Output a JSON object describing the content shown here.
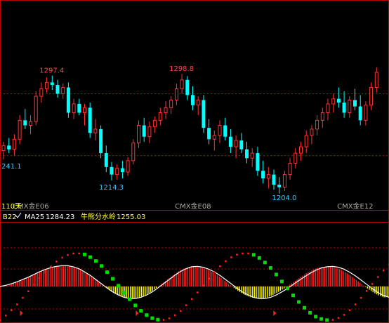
{
  "chart_data": [
    {
      "type": "candlestick",
      "title": "",
      "price_labels": [
        {
          "text": "1297.4",
          "kind": "high",
          "bar": 9
        },
        {
          "text": "1298.8",
          "kind": "high",
          "bar": 33
        },
        {
          "text": "241.1",
          "kind": "low",
          "bar": 0
        },
        {
          "text": "1214.3",
          "kind": "low",
          "bar": 20
        },
        {
          "text": "1204.0",
          "kind": "low",
          "bar": 52
        }
      ],
      "contract_labels": [
        {
          "text": "CMX金E06",
          "bar": 3
        },
        {
          "text": "CMX金E08",
          "bar": 33
        },
        {
          "text": "CMX金E12",
          "bar": 63
        }
      ],
      "period_label": "110天",
      "ylim": [
        1196,
        1310
      ],
      "reference_lines": [
        1283,
        1234
      ],
      "colors": {
        "up": "#ff3333",
        "down": "#00ffff",
        "ref": "#c00000",
        "high_label": "#ff4444",
        "low_label": "#33ccff"
      },
      "ohlc": [
        [
          1238,
          1245,
          1231,
          1242
        ],
        [
          1242,
          1248,
          1236,
          1239
        ],
        [
          1239,
          1251,
          1234,
          1247
        ],
        [
          1247,
          1266,
          1243,
          1262
        ],
        [
          1262,
          1271,
          1255,
          1258
        ],
        [
          1258,
          1266,
          1251,
          1261
        ],
        [
          1261,
          1285,
          1258,
          1281
        ],
        [
          1281,
          1292,
          1276,
          1287
        ],
        [
          1287,
          1296,
          1284,
          1292
        ],
        [
          1292,
          1297.4,
          1286,
          1290
        ],
        [
          1290,
          1294,
          1280,
          1283
        ],
        [
          1283,
          1291,
          1279,
          1288
        ],
        [
          1288,
          1292,
          1264,
          1268
        ],
        [
          1268,
          1279,
          1263,
          1275
        ],
        [
          1275,
          1279,
          1266,
          1268
        ],
        [
          1268,
          1275,
          1258,
          1272
        ],
        [
          1272,
          1276,
          1248,
          1252
        ],
        [
          1252,
          1263,
          1246,
          1255
        ],
        [
          1255,
          1258,
          1232,
          1236
        ],
        [
          1236,
          1242,
          1221,
          1225
        ],
        [
          1225,
          1229,
          1214.3,
          1219
        ],
        [
          1219,
          1227,
          1215,
          1224
        ],
        [
          1224,
          1230,
          1216,
          1221
        ],
        [
          1221,
          1233,
          1218,
          1230
        ],
        [
          1230,
          1247,
          1227,
          1244
        ],
        [
          1244,
          1262,
          1240,
          1258
        ],
        [
          1258,
          1264,
          1245,
          1249
        ],
        [
          1249,
          1261,
          1244,
          1257
        ],
        [
          1257,
          1265,
          1252,
          1262
        ],
        [
          1262,
          1272,
          1258,
          1268
        ],
        [
          1268,
          1277,
          1263,
          1272
        ],
        [
          1272,
          1281,
          1267,
          1278
        ],
        [
          1278,
          1291,
          1274,
          1287
        ],
        [
          1287,
          1298.8,
          1283,
          1294
        ],
        [
          1294,
          1297,
          1278,
          1282
        ],
        [
          1282,
          1289,
          1270,
          1274
        ],
        [
          1274,
          1281,
          1266,
          1278
        ],
        [
          1278,
          1282,
          1252,
          1256
        ],
        [
          1256,
          1263,
          1243,
          1247
        ],
        [
          1247,
          1254,
          1238,
          1250
        ],
        [
          1250,
          1262,
          1244,
          1258
        ],
        [
          1258,
          1264,
          1246,
          1249
        ],
        [
          1249,
          1255,
          1236,
          1241
        ],
        [
          1241,
          1250,
          1232,
          1246
        ],
        [
          1246,
          1252,
          1236,
          1239
        ],
        [
          1239,
          1245,
          1228,
          1232
        ],
        [
          1232,
          1240,
          1225,
          1236
        ],
        [
          1236,
          1241,
          1218,
          1222
        ],
        [
          1222,
          1230,
          1212,
          1216
        ],
        [
          1216,
          1225,
          1208,
          1219
        ],
        [
          1219,
          1223,
          1207,
          1211
        ],
        [
          1211,
          1217,
          1204.0,
          1209
        ],
        [
          1209,
          1222,
          1206,
          1219
        ],
        [
          1219,
          1232,
          1215,
          1228
        ],
        [
          1228,
          1240,
          1224,
          1236
        ],
        [
          1236,
          1245,
          1230,
          1241
        ],
        [
          1241,
          1254,
          1236,
          1250
        ],
        [
          1250,
          1258,
          1243,
          1255
        ],
        [
          1255,
          1266,
          1250,
          1262
        ],
        [
          1262,
          1272,
          1256,
          1268
        ],
        [
          1268,
          1279,
          1262,
          1275
        ],
        [
          1275,
          1283,
          1268,
          1279
        ],
        [
          1279,
          1288,
          1272,
          1276
        ],
        [
          1276,
          1285,
          1264,
          1268
        ],
        [
          1268,
          1281,
          1264,
          1278
        ],
        [
          1278,
          1287,
          1270,
          1273
        ],
        [
          1273,
          1282,
          1258,
          1262
        ],
        [
          1262,
          1277,
          1258,
          1274
        ],
        [
          1274,
          1292,
          1270,
          1288
        ],
        [
          1288,
          1304,
          1284,
          1300
        ]
      ]
    },
    {
      "type": "indicator",
      "header": {
        "name": "B22",
        "ma_label": "MA25",
        "ma_value": "1284.23",
        "aux_label": "牛熊分水岭",
        "aux_value": "1255.03"
      },
      "colors": {
        "header_name": "#ffff33",
        "ma": "#ffffff",
        "aux": "#ffff33",
        "pos_bar": "#ff2020",
        "neg_bar": "#ffff00",
        "dot_up": "#ff2020",
        "dot_down": "#00dd00",
        "line": "#ffffff"
      },
      "ylim": [
        -1,
        1
      ],
      "midline": 0,
      "dots_series": [
        -0.87,
        -0.75,
        -0.61,
        -0.46,
        -0.29,
        -0.12,
        0.05,
        0.22,
        0.38,
        0.52,
        0.65,
        0.75,
        0.82,
        0.86,
        0.86,
        0.83,
        0.76,
        0.66,
        0.53,
        0.37,
        0.2,
        0.02,
        -0.16,
        -0.33,
        -0.49,
        -0.63,
        -0.74,
        -0.82,
        -0.86,
        -0.86,
        -0.82,
        -0.74,
        -0.63,
        -0.48,
        -0.32,
        -0.15,
        0.03,
        0.21,
        0.38,
        0.53,
        0.66,
        0.76,
        0.83,
        0.86,
        0.86,
        0.82,
        0.74,
        0.62,
        0.48,
        0.31,
        0.13,
        -0.05,
        -0.23,
        -0.4,
        -0.55,
        -0.68,
        -0.78,
        -0.84,
        -0.87,
        -0.86,
        -0.81,
        -0.73,
        -0.61,
        -0.46,
        -0.29,
        -0.11,
        0.07,
        0.25,
        0.42,
        0.57
      ],
      "curve_series": [
        0.0,
        0.03,
        0.07,
        0.12,
        0.18,
        0.24,
        0.31,
        0.38,
        0.44,
        0.49,
        0.52,
        0.54,
        0.54,
        0.51,
        0.46,
        0.38,
        0.29,
        0.18,
        0.07,
        -0.04,
        -0.14,
        -0.22,
        -0.28,
        -0.31,
        -0.31,
        -0.28,
        -0.22,
        -0.14,
        -0.04,
        0.07,
        0.18,
        0.29,
        0.39,
        0.46,
        0.51,
        0.52,
        0.5,
        0.45,
        0.38,
        0.29,
        0.18,
        0.07,
        -0.04,
        -0.14,
        -0.22,
        -0.28,
        -0.31,
        -0.31,
        -0.28,
        -0.22,
        -0.14,
        -0.05,
        0.05,
        0.15,
        0.25,
        0.34,
        0.42,
        0.48,
        0.51,
        0.52,
        0.5,
        0.45,
        0.37,
        0.28,
        0.17,
        0.06,
        -0.05,
        -0.15,
        -0.23,
        -0.28
      ],
      "markers": [
        3,
        24,
        49,
        70
      ]
    }
  ]
}
